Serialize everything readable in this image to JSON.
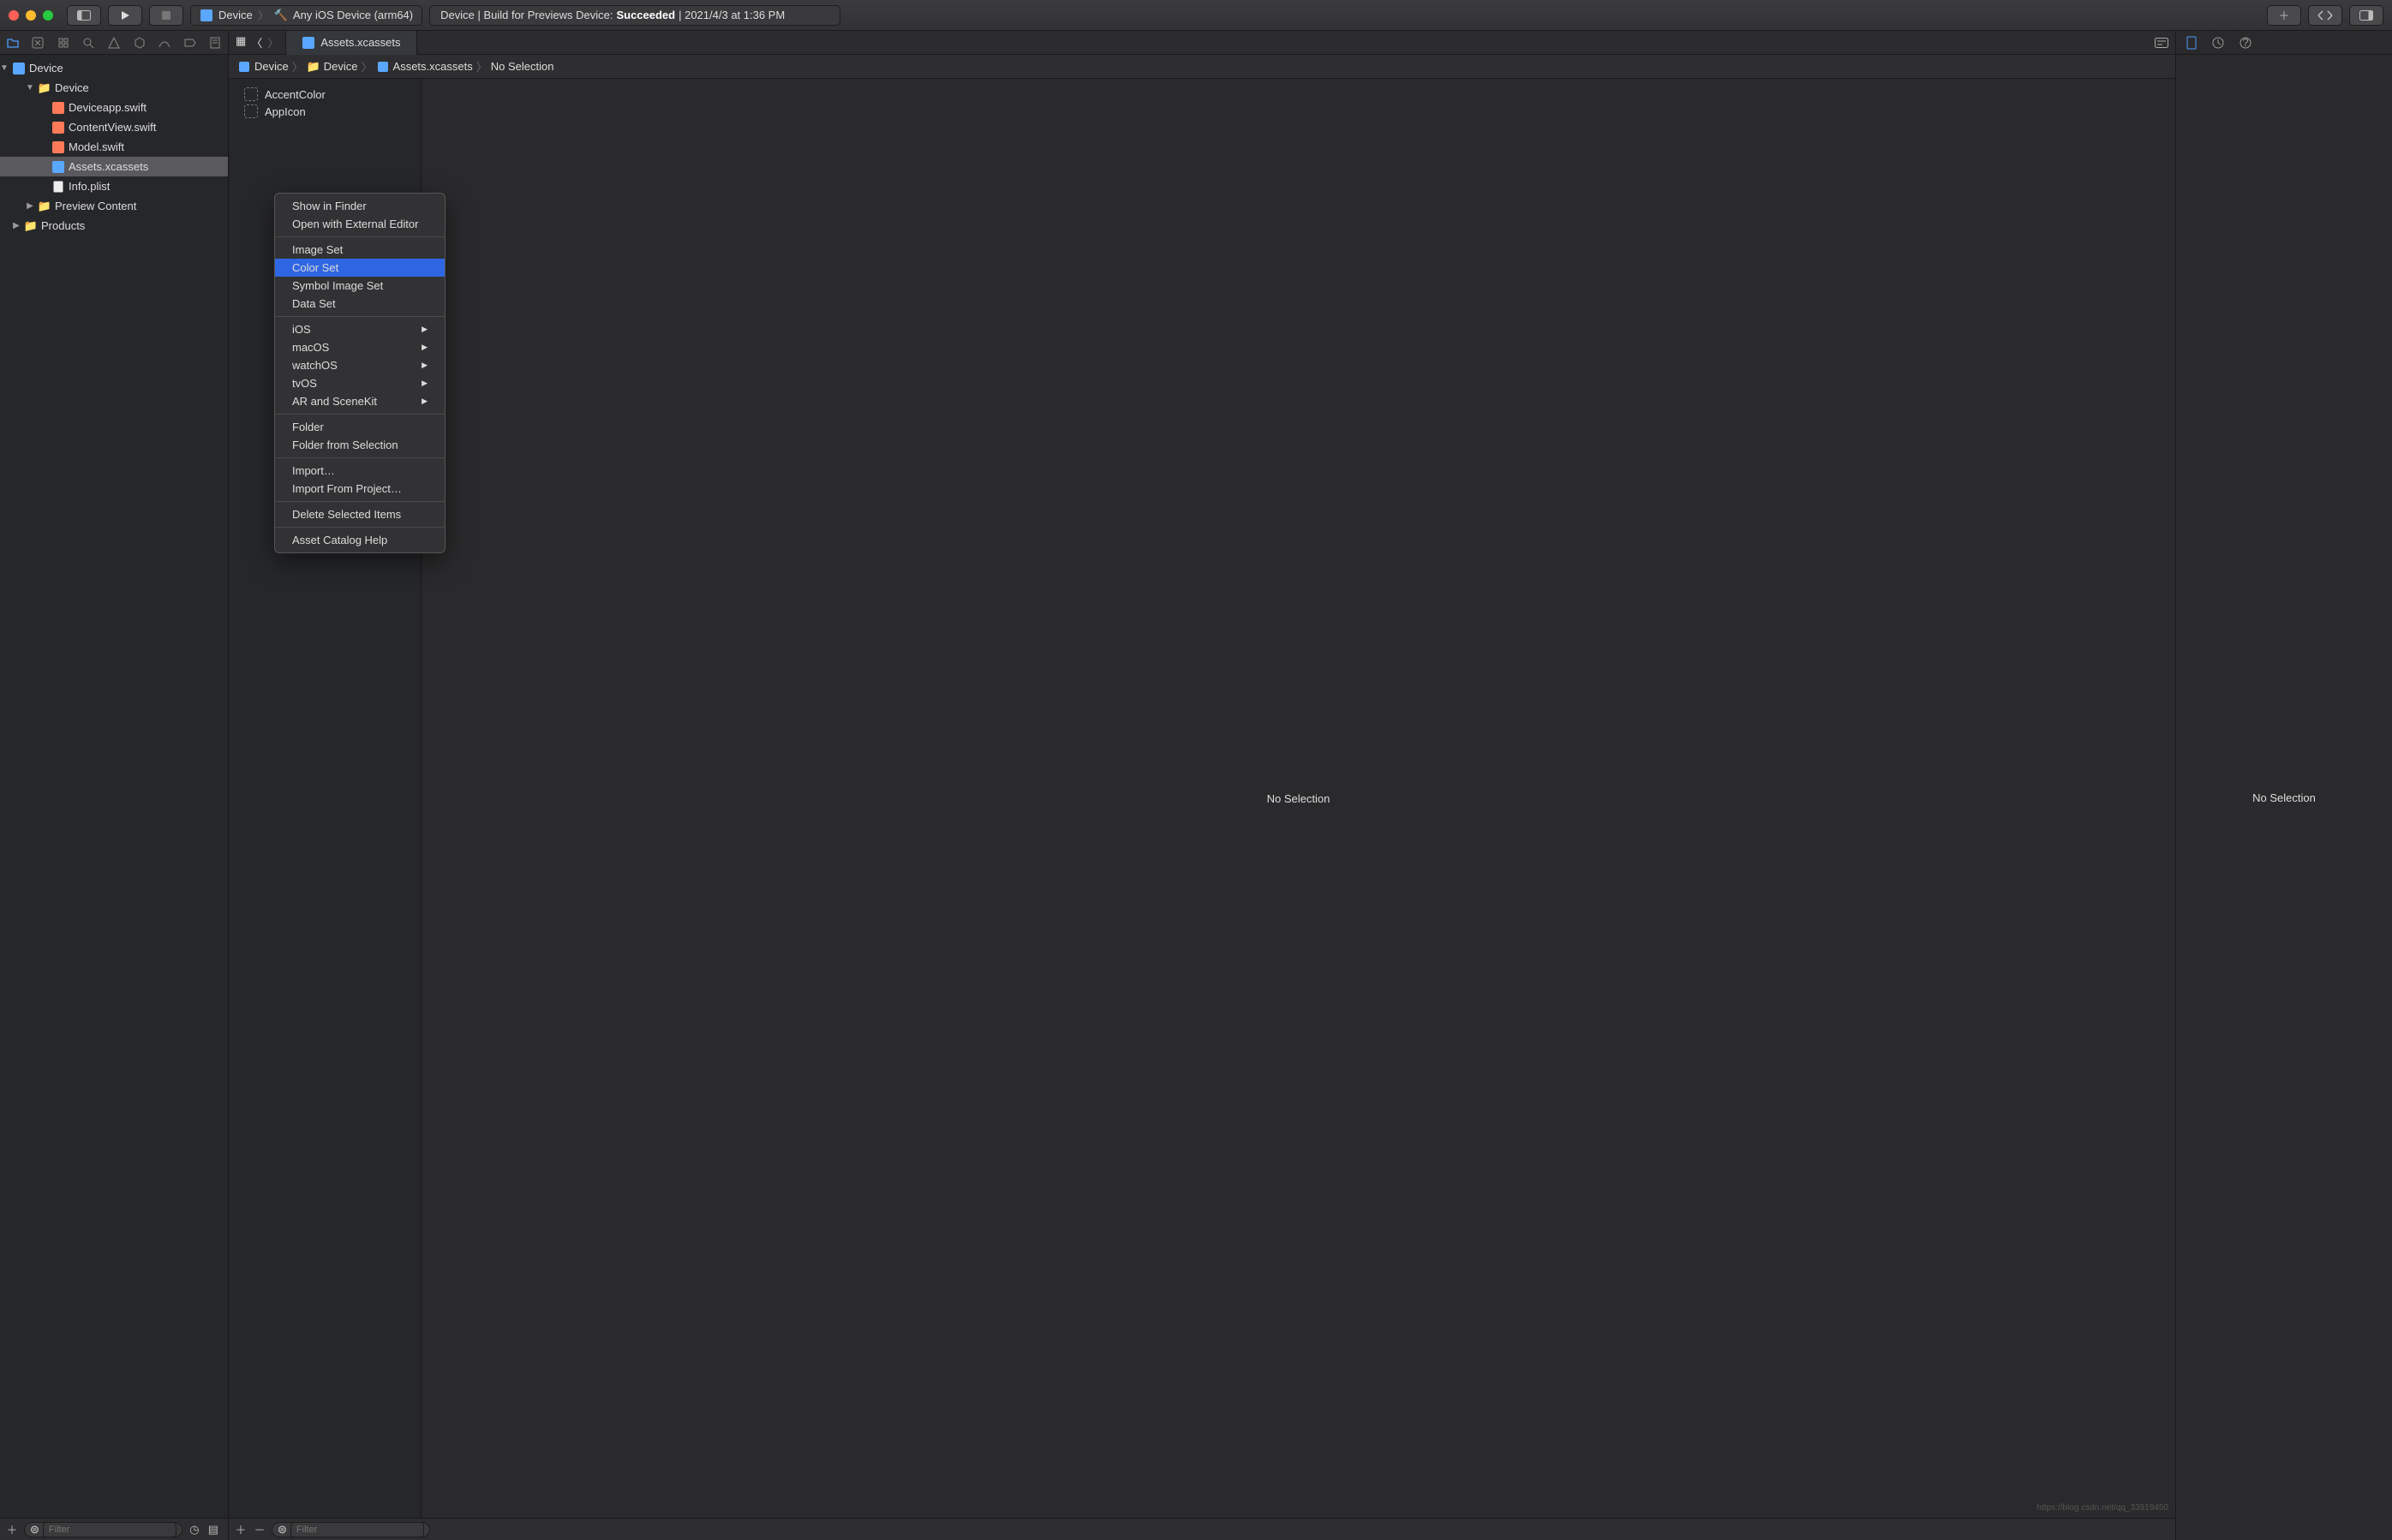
{
  "titlebar": {
    "scheme_target": "Device",
    "scheme_device": "Any iOS Device (arm64)",
    "status_prefix": "Device | Build for Previews Device:",
    "status_result": "Succeeded",
    "status_time": "| 2021/4/3 at 1:36 PM"
  },
  "tab": {
    "label": "Assets.xcassets"
  },
  "jumpbar": [
    "Device",
    "Device",
    "Assets.xcassets",
    "No Selection"
  ],
  "navigator": {
    "project": "Device",
    "tree": [
      {
        "label": "Device",
        "icon": "folder",
        "depth": 1,
        "open": true
      },
      {
        "label": "Deviceapp.swift",
        "icon": "swift",
        "depth": 2
      },
      {
        "label": "ContentView.swift",
        "icon": "swift",
        "depth": 2
      },
      {
        "label": "Model.swift",
        "icon": "swift",
        "depth": 2
      },
      {
        "label": "Assets.xcassets",
        "icon": "assets",
        "depth": 2,
        "selected": true
      },
      {
        "label": "Info.plist",
        "icon": "plist",
        "depth": 2
      },
      {
        "label": "Preview Content",
        "icon": "folder-y",
        "depth": 1,
        "closed": true
      },
      {
        "label": "Products",
        "icon": "folder-y",
        "depth": 0,
        "closed": true,
        "indent": 1
      }
    ]
  },
  "assets": {
    "items": [
      "AccentColor",
      "AppIcon"
    ],
    "no_selection": "No Selection"
  },
  "inspector": {
    "no_selection": "No Selection"
  },
  "context_menu": [
    {
      "label": "Show in Finder",
      "disabled": true
    },
    {
      "label": "Open with External Editor",
      "disabled": true
    },
    {
      "sep": true
    },
    {
      "label": "Image Set"
    },
    {
      "label": "Color Set",
      "selected": true
    },
    {
      "label": "Symbol Image Set"
    },
    {
      "label": "Data Set"
    },
    {
      "sep": true
    },
    {
      "label": "iOS",
      "submenu": true
    },
    {
      "label": "macOS",
      "submenu": true
    },
    {
      "label": "watchOS",
      "submenu": true
    },
    {
      "label": "tvOS",
      "submenu": true
    },
    {
      "label": "AR and SceneKit",
      "submenu": true
    },
    {
      "sep": true
    },
    {
      "label": "Folder"
    },
    {
      "label": "Folder from Selection",
      "disabled": true
    },
    {
      "sep": true
    },
    {
      "label": "Import…"
    },
    {
      "label": "Import From Project…"
    },
    {
      "sep": true
    },
    {
      "label": "Delete Selected Items",
      "disabled": true
    },
    {
      "sep": true
    },
    {
      "label": "Asset Catalog Help"
    }
  ],
  "filters": {
    "left_placeholder": "Filter",
    "asset_placeholder": "Filter"
  },
  "watermark": "https://blog.csdn.net/qq_33919450"
}
